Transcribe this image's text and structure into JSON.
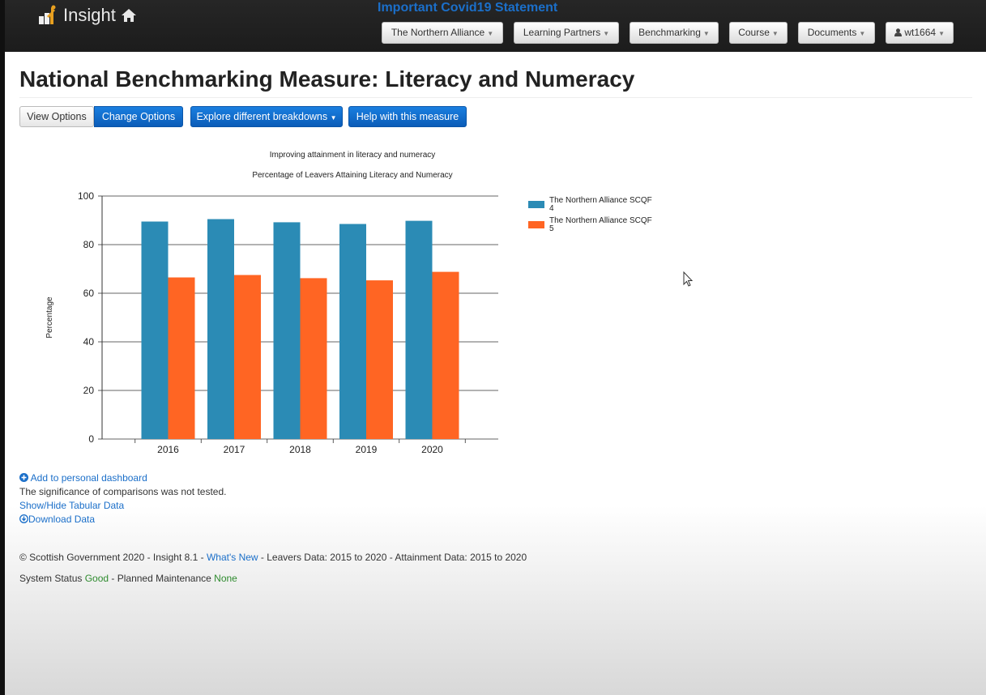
{
  "navbar": {
    "brand": "Insight",
    "notice": "Important Covid19 Statement",
    "menus": [
      "The Northern Alliance",
      "Learning Partners",
      "Benchmarking",
      "Course",
      "Documents",
      "wt1664"
    ]
  },
  "page": {
    "title": "National Benchmarking Measure: Literacy and Numeracy"
  },
  "toolbar": {
    "view_options": "View Options",
    "change_options": "Change Options",
    "explore": "Explore different breakdowns",
    "help": "Help with this measure"
  },
  "chart_data": {
    "type": "bar",
    "title": "Improving attainment in literacy and numeracy",
    "subtitle": "Percentage of Leavers Attaining Literacy and Numeracy",
    "ylabel": "Percentage",
    "xlabel": "",
    "categories": [
      "2016",
      "2017",
      "2018",
      "2019",
      "2020"
    ],
    "ylim": [
      0,
      100
    ],
    "yticks": [
      0,
      20,
      40,
      60,
      80,
      100
    ],
    "grid": true,
    "legend_position": "right",
    "series": [
      {
        "name": "The Northern Alliance SCQF 4",
        "color": "#2b8bb5",
        "values": [
          89.5,
          90.5,
          89.2,
          88.5,
          89.8
        ]
      },
      {
        "name": "The Northern Alliance SCQF 5",
        "color": "#ff6523",
        "values": [
          66.5,
          67.5,
          66.2,
          65.3,
          68.8
        ]
      }
    ]
  },
  "actions": {
    "dashboard": "Add to personal dashboard",
    "significance": "The significance of comparisons was not tested.",
    "tabular": "Show/Hide Tabular Data",
    "download": "Download Data"
  },
  "footer": {
    "copyright": "© Scottish Government 2020 - Insight 8.1 - ",
    "whats_new": "What's New",
    "data_info": " - Leavers Data: 2015 to 2020 - Attainment Data: 2015 to 2020",
    "status_prefix": "System Status ",
    "status_value": "Good",
    "maintenance_prefix": " - Planned Maintenance ",
    "maintenance_value": "None"
  }
}
